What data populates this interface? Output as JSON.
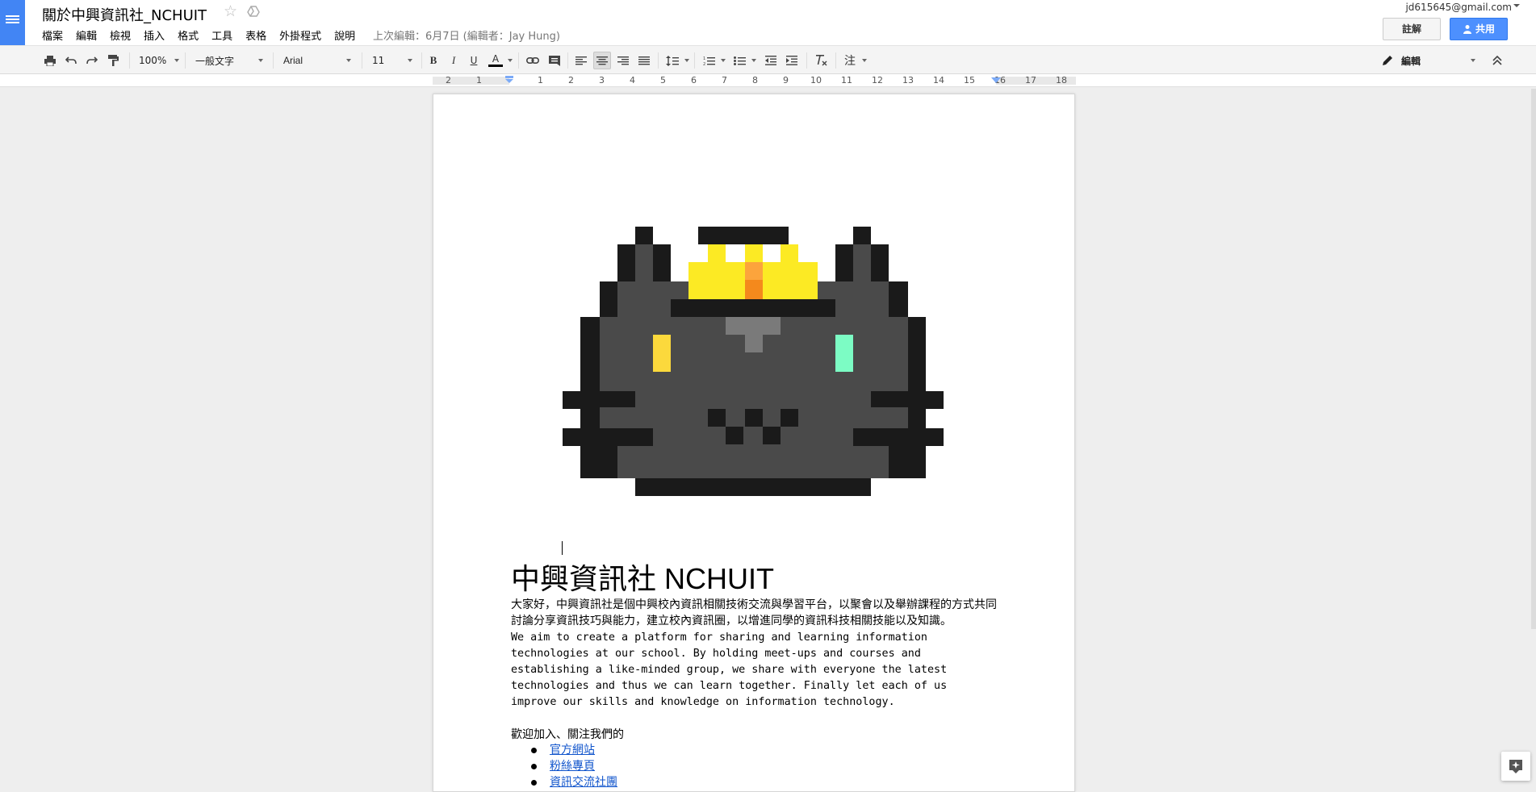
{
  "header": {
    "title": "關於中興資訊社_NCHUIT",
    "last_edit": "上次編輯：6月7日 (編輯者：Jay Hung)",
    "account": "jd615645@gmail.com",
    "comments_label": "註解",
    "share_label": "共用"
  },
  "menu": [
    "檔案",
    "編輯",
    "檢視",
    "插入",
    "格式",
    "工具",
    "表格",
    "外掛程式",
    "說明"
  ],
  "toolbar": {
    "zoom": "100%",
    "style": "一般文字",
    "font": "Arial",
    "size": "11",
    "bold": "B",
    "italic": "I",
    "underline": "U",
    "text_color": "A",
    "annotation": "注",
    "mode": "編輯"
  },
  "ruler": {
    "numbers": [
      "2",
      "1",
      "1",
      "2",
      "3",
      "4",
      "5",
      "6",
      "7",
      "8",
      "9",
      "10",
      "11",
      "12",
      "13",
      "14",
      "15",
      "16",
      "17",
      "18"
    ]
  },
  "document": {
    "heading": "中興資訊社 NCHUIT",
    "intro_zh": "大家好，中興資訊社是個中興校內資訊相關技術交流與學習平台，以聚會以及舉辦課程的方式共同討論分享資訊技巧與能力，建立校內資訊圈，以增進同學的資訊科技相關技能以及知識。",
    "intro_en": "We aim to create a platform for sharing and learning information\ntechnologies at our school. By holding meet-ups and courses and\nestablishing a like-minded group, we share with everyone the latest\ntechnologies and thus we can learn together. Finally let each of us\nimprove our skills and knowledge on information technology.",
    "welcome": "歡迎加入、關注我們的",
    "links": [
      "官方網站",
      "粉絲專頁",
      "資訊交流社團"
    ]
  },
  "colors": {
    "brand": "#4285f4",
    "share": "#4d90fe",
    "link": "#1155cc",
    "cat_outline": "#1a1a1a",
    "cat_body": "#4a4a4a",
    "crown": "#fcea24",
    "gem_top": "#fca43c",
    "gem_bottom": "#f4891c",
    "eye_left": "#fcd93c",
    "eye_right": "#7cfcc4",
    "nose": "#7a7a7a"
  },
  "icons": [
    "docs-menu-icon",
    "star-icon",
    "drive-move-icon",
    "print-icon",
    "undo-icon",
    "redo-icon",
    "paint-format-icon",
    "link-icon",
    "comment-icon",
    "align-left-icon",
    "align-center-icon",
    "align-right-icon",
    "align-justify-icon",
    "line-spacing-icon",
    "numbered-list-icon",
    "bulleted-list-icon",
    "decrease-indent-icon",
    "increase-indent-icon",
    "clear-formatting-icon",
    "pencil-icon",
    "collapse-icon",
    "share-person-icon",
    "explore-icon"
  ]
}
